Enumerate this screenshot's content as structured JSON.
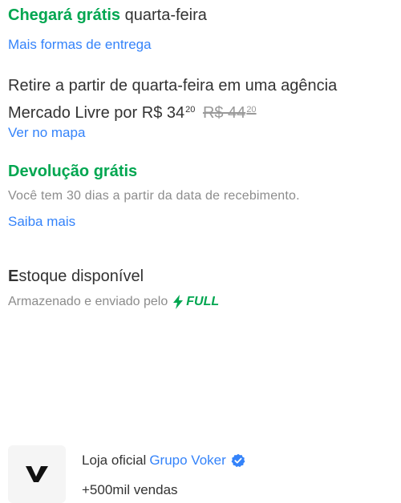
{
  "shipping": {
    "title_bold": "Chegará grátis",
    "title_rest": " quarta-feira",
    "more_options_link": "Mais formas de entrega"
  },
  "pickup": {
    "text": "Retire a partir de quarta-feira em uma agência Mercado Livre por",
    "price_current_int": "R$ 34",
    "price_current_cents": "20",
    "price_old_int": "R$ 44",
    "price_old_cents": "20",
    "map_link": "Ver no mapa"
  },
  "returns": {
    "title": "Devolução grátis",
    "description": "Você tem 30 dias a partir da data de recebimento.",
    "learn_more_link": "Saiba mais"
  },
  "stock": {
    "title_first_letter": "E",
    "title_rest": "stoque disponível",
    "subtitle": "Armazenado e enviado pelo",
    "badge_text": "FULL",
    "badge_icon": "lightning-bolt-icon"
  },
  "seller": {
    "logo_icon": "voker-logo-icon",
    "store_label": "Loja oficial",
    "store_name": "Grupo Voker",
    "verified_icon": "verified-check-icon",
    "sales": "+500mil vendas"
  },
  "colors": {
    "green": "#00a650",
    "link_blue": "#3483fa",
    "text": "#333333",
    "muted": "#8c8c8c"
  }
}
